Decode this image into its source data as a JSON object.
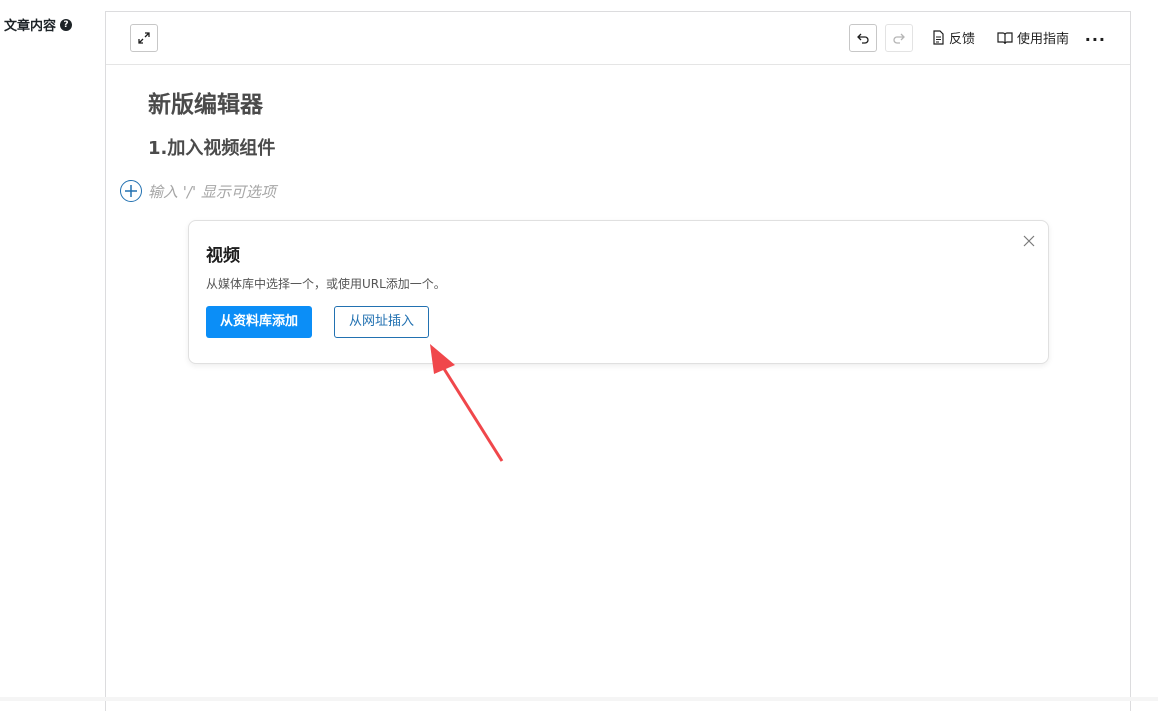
{
  "field": {
    "label": "文章内容",
    "help_icon": "?"
  },
  "toolbar": {
    "expand_icon": "expand-icon",
    "undo_icon": "undo-icon",
    "redo_icon": "redo-icon",
    "feedback_label": "反馈",
    "guide_label": "使用指南",
    "more_icon": "..."
  },
  "document": {
    "title": "新版编辑器",
    "heading": "1.加入视频组件",
    "placeholder": "输入 '/' 显示可选项"
  },
  "video_block": {
    "title": "视频",
    "description": "从媒体库中选择一个，或使用URL添加一个。",
    "library_button": "从资料库添加",
    "url_button": "从网址插入"
  },
  "colors": {
    "primary": "#0b8ef7",
    "accent": "#2271b1",
    "annotation": "#f0474b"
  }
}
